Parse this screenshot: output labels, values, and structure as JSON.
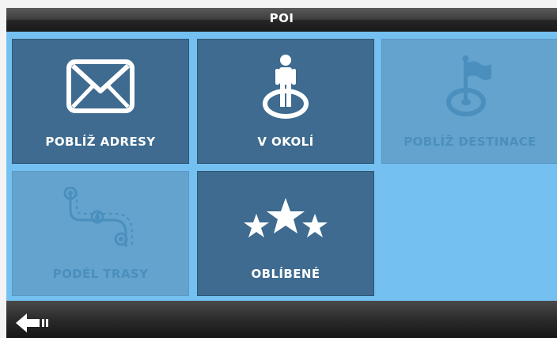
{
  "window": {
    "title": "POI"
  },
  "tiles": [
    {
      "label": "POBLÍŽ ADRESY",
      "icon": "envelope-icon",
      "enabled": true
    },
    {
      "label": "V OKOLÍ",
      "icon": "person-location-icon",
      "enabled": true
    },
    {
      "label": "POBLÍŽ DESTINACE",
      "icon": "destination-flag-icon",
      "enabled": false
    },
    {
      "label": "PODÉL TRASY",
      "icon": "route-icon",
      "enabled": false
    },
    {
      "label": "OBLÍBENÉ",
      "icon": "stars-icon",
      "enabled": true
    }
  ],
  "footer": {
    "back_icon": "back-arrow-icon"
  },
  "colors": {
    "content_bg": "#74c0f0",
    "tile_active": "#3e6b8f",
    "tile_disabled": "#64a3cd",
    "bar_dark": "#1a1a1a"
  }
}
